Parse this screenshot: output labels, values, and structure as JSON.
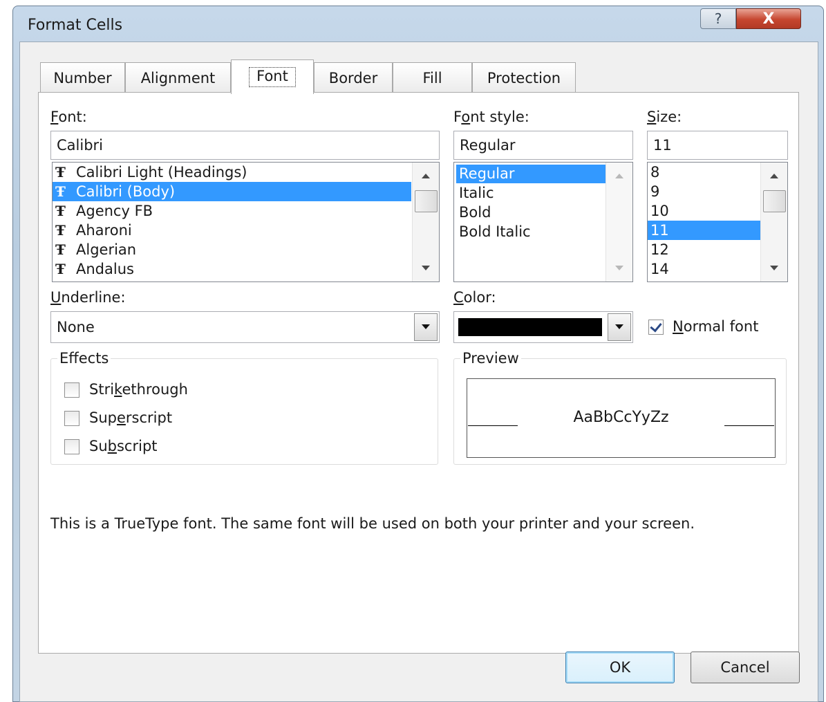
{
  "window": {
    "title": "Format Cells",
    "help_symbol": "?",
    "close_symbol": "X"
  },
  "tabs": [
    {
      "label": "Number"
    },
    {
      "label": "Alignment"
    },
    {
      "label": "Font",
      "active": true
    },
    {
      "label": "Border"
    },
    {
      "label": "Fill"
    },
    {
      "label": "Protection"
    }
  ],
  "font": {
    "label_first": "F",
    "label_rest": "ont:",
    "value": "Calibri",
    "items": [
      "Calibri Light (Headings)",
      "Calibri (Body)",
      "Agency FB",
      "Aharoni",
      "Algerian",
      "Andalus"
    ],
    "selected_index": 1,
    "item_icon": "truetype-icon",
    "icon_glyph": "Ŧ"
  },
  "font_style": {
    "label_a": "F",
    "label_u": "o",
    "label_b": "nt style:",
    "value": "Regular",
    "items": [
      "Regular",
      "Italic",
      "Bold",
      "Bold Italic"
    ],
    "selected_index": 0
  },
  "size": {
    "label_first": "S",
    "label_rest": "ize:",
    "value": "11",
    "items": [
      "8",
      "9",
      "10",
      "11",
      "12",
      "14"
    ],
    "selected_index": 3
  },
  "underline": {
    "label_first": "U",
    "label_rest": "nderline:",
    "value": "None"
  },
  "color": {
    "label_first": "C",
    "label_rest": "olor:",
    "value_color": "#000000"
  },
  "normal_font": {
    "label_first": "N",
    "label_rest": "ormal font",
    "checked": true
  },
  "effects": {
    "legend": "Effects",
    "strikethrough": {
      "a": "Stri",
      "u": "k",
      "b": "ethrough",
      "checked": false
    },
    "superscript": {
      "a": "Sup",
      "u": "e",
      "b": "rscript",
      "checked": false
    },
    "subscript": {
      "a": "Su",
      "u": "b",
      "b": "script",
      "checked": false
    }
  },
  "preview": {
    "legend": "Preview",
    "sample": "AaBbCcYyZz"
  },
  "info_text": "This is a TrueType font.  The same font will be used on both your printer and your screen.",
  "buttons": {
    "ok": "OK",
    "cancel": "Cancel"
  },
  "colors": {
    "selection": "#3399ff",
    "title_bar": "#c6d8ea",
    "close_button": "#c6462f"
  }
}
